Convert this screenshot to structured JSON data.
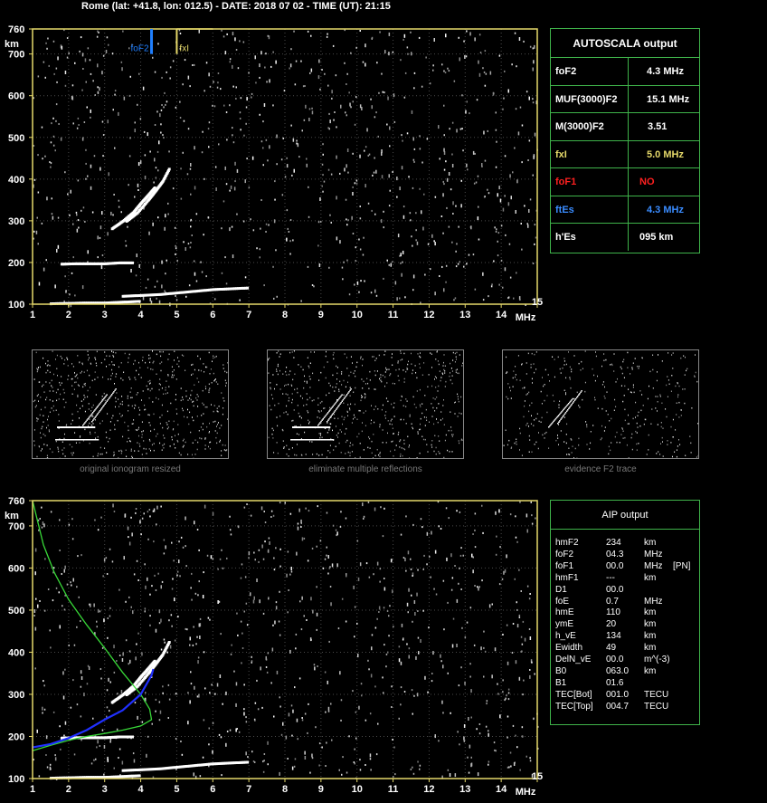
{
  "header": {
    "title": "Rome (lat: +41.8, lon: 012.5) - DATE: 2018 07 02 - TIME (UT): 21:15"
  },
  "colors": {
    "frame": "#e6d96a",
    "grid": "#4a4a4a",
    "panel_border": "#3fb34a",
    "foF2_marker": "#1f7fff",
    "fxI_marker": "#e6d96a",
    "value_white": "#ffffff",
    "value_yellow": "#e6d96a",
    "value_red": "#ff2020",
    "value_blue": "#3a8cff",
    "profile_green": "#38d838",
    "profile_blue": "#2030ff"
  },
  "chart_data": [
    {
      "type": "scatter",
      "id": "ionogram-top",
      "xlabel": "MHz",
      "ylabel": "km",
      "xlim": [
        1,
        15
      ],
      "ylim": [
        100,
        760
      ],
      "xticks": [
        1,
        2,
        3,
        4,
        5,
        6,
        7,
        8,
        9,
        10,
        11,
        12,
        13,
        14,
        15
      ],
      "yticks": [
        100,
        200,
        300,
        400,
        500,
        600,
        700,
        760
      ],
      "grid": true,
      "markers": [
        {
          "label": "foF2",
          "x": 4.3
        },
        {
          "label": "fxI",
          "x": 5.0
        }
      ],
      "traces": [
        {
          "name": "",
          "points": [
            [
              1.5,
              102
            ],
            [
              2.0,
              103
            ],
            [
              2.5,
              104
            ],
            [
              3.0,
              104
            ],
            [
              3.5,
              106
            ],
            [
              4.0,
              108
            ]
          ]
        },
        {
          "name": "",
          "points": [
            [
              1.8,
              197
            ],
            [
              2.2,
              198
            ],
            [
              2.6,
              198
            ],
            [
              3.0,
              198
            ],
            [
              3.4,
              200
            ],
            [
              3.8,
              200
            ]
          ]
        },
        {
          "name": "",
          "points": [
            [
              3.2,
              282
            ],
            [
              3.5,
              300
            ],
            [
              3.8,
              322
            ],
            [
              4.0,
              343
            ],
            [
              4.2,
              362
            ],
            [
              4.4,
              382
            ]
          ]
        },
        {
          "name": "",
          "points": [
            [
              3.6,
              300
            ],
            [
              3.9,
              320
            ],
            [
              4.2,
              350
            ],
            [
              4.4,
              372
            ],
            [
              4.6,
              395
            ],
            [
              4.8,
              428
            ]
          ]
        },
        {
          "name": "",
          "points": [
            [
              3.5,
              120
            ],
            [
              4.0,
              122
            ],
            [
              4.5,
              124
            ],
            [
              5.0,
              128
            ],
            [
              5.5,
              132
            ],
            [
              6.0,
              136
            ],
            [
              6.5,
              138
            ],
            [
              7.0,
              140
            ]
          ]
        }
      ]
    },
    {
      "type": "scatter",
      "id": "ionogram-bottom",
      "xlabel": "MHz",
      "ylabel": "km",
      "xlim": [
        1,
        15
      ],
      "ylim": [
        100,
        760
      ],
      "xticks": [
        1,
        2,
        3,
        4,
        5,
        6,
        7,
        8,
        9,
        10,
        11,
        12,
        13,
        14,
        15
      ],
      "yticks": [
        100,
        200,
        300,
        400,
        500,
        600,
        700,
        760
      ],
      "grid": true,
      "traces": [
        {
          "name": "",
          "points": [
            [
              1.5,
              102
            ],
            [
              2.0,
              103
            ],
            [
              2.5,
              104
            ],
            [
              3.0,
              104
            ],
            [
              3.5,
              106
            ],
            [
              4.0,
              108
            ]
          ]
        },
        {
          "name": "",
          "points": [
            [
              1.8,
              197
            ],
            [
              2.2,
              198
            ],
            [
              2.6,
              198
            ],
            [
              3.0,
              198
            ],
            [
              3.4,
              200
            ],
            [
              3.8,
              200
            ]
          ]
        },
        {
          "name": "",
          "points": [
            [
              3.2,
              282
            ],
            [
              3.5,
              300
            ],
            [
              3.8,
              322
            ],
            [
              4.0,
              343
            ],
            [
              4.2,
              362
            ],
            [
              4.4,
              382
            ]
          ]
        },
        {
          "name": "",
          "points": [
            [
              3.6,
              300
            ],
            [
              3.9,
              320
            ],
            [
              4.2,
              350
            ],
            [
              4.4,
              372
            ],
            [
              4.6,
              395
            ],
            [
              4.8,
              428
            ]
          ]
        },
        {
          "name": "",
          "points": [
            [
              3.5,
              120
            ],
            [
              4.0,
              122
            ],
            [
              4.5,
              124
            ],
            [
              5.0,
              128
            ],
            [
              5.5,
              132
            ],
            [
              6.0,
              136
            ],
            [
              6.5,
              138
            ],
            [
              7.0,
              140
            ]
          ]
        }
      ],
      "profiles": [
        {
          "name": "",
          "color": "profile_green",
          "points": [
            [
              1.0,
              760
            ],
            [
              1.3,
              655
            ],
            [
              1.6,
              590
            ],
            [
              2.0,
              525
            ],
            [
              2.5,
              465
            ],
            [
              3.0,
              410
            ],
            [
              3.5,
              352
            ],
            [
              4.0,
              300
            ],
            [
              4.25,
              265
            ],
            [
              4.3,
              240
            ],
            [
              4.0,
              225
            ],
            [
              3.5,
              215
            ],
            [
              3.0,
              207
            ],
            [
              2.5,
              200
            ],
            [
              2.0,
              191
            ],
            [
              1.5,
              179
            ],
            [
              1.0,
              166
            ]
          ]
        },
        {
          "name": "",
          "color": "profile_blue",
          "points": [
            [
              1.0,
              174
            ],
            [
              1.5,
              182
            ],
            [
              2.0,
              196
            ],
            [
              2.5,
              215
            ],
            [
              3.0,
              240
            ],
            [
              3.5,
              262
            ],
            [
              4.0,
              300
            ],
            [
              4.3,
              345
            ],
            [
              4.35,
              360
            ]
          ]
        }
      ]
    }
  ],
  "autoscala": {
    "title": "AUTOSCALA output",
    "rows": [
      {
        "label": "foF2",
        "value": "4.3 MHz",
        "label_color": "value_white",
        "value_color": "value_white"
      },
      {
        "label": "MUF(3000)F2",
        "value": "15.1 MHz",
        "label_color": "value_white",
        "value_color": "value_white"
      },
      {
        "label": "M(3000)F2",
        "value": "3.51",
        "label_color": "value_white",
        "value_color": "value_white"
      },
      {
        "label": "fxI",
        "value": "5.0 MHz",
        "label_color": "value_yellow",
        "value_color": "value_yellow"
      },
      {
        "label": "foF1",
        "value": "NO",
        "label_color": "value_red",
        "value_color": "value_red"
      },
      {
        "label": "ftEs",
        "value": "4.3 MHz",
        "label_color": "value_blue",
        "value_color": "value_blue"
      },
      {
        "label": "h'Es",
        "value": "095     km",
        "label_color": "value_white",
        "value_color": "value_white"
      }
    ]
  },
  "thumbnails": [
    {
      "caption": "original ionogram resized"
    },
    {
      "caption": "eliminate multiple reflections"
    },
    {
      "caption": "evidence F2 trace"
    }
  ],
  "aip": {
    "title": "AIP output",
    "rows": [
      {
        "param": "hmF2",
        "value": "234",
        "unit": "km",
        "extra": ""
      },
      {
        "param": "foF2",
        "value": "04.3",
        "unit": "MHz",
        "extra": ""
      },
      {
        "param": "foF1",
        "value": "00.0",
        "unit": "MHz",
        "extra": "[PN]"
      },
      {
        "param": "hmF1",
        "value": "---",
        "unit": "km",
        "extra": ""
      },
      {
        "param": "D1",
        "value": "00.0",
        "unit": "",
        "extra": ""
      },
      {
        "param": "foE",
        "value": "0.7",
        "unit": "MHz",
        "extra": ""
      },
      {
        "param": "hmE",
        "value": "110",
        "unit": "km",
        "extra": ""
      },
      {
        "param": "ymE",
        "value": "20",
        "unit": "km",
        "extra": ""
      },
      {
        "param": "h_vE",
        "value": "134",
        "unit": "km",
        "extra": ""
      },
      {
        "param": "Ewidth",
        "value": "49",
        "unit": "km",
        "extra": ""
      },
      {
        "param": "DelN_vE",
        "value": "00.0",
        "unit": "m^(-3)",
        "extra": ""
      },
      {
        "param": "B0",
        "value": "063.0",
        "unit": "km",
        "extra": ""
      },
      {
        "param": "B1",
        "value": "01.6",
        "unit": "",
        "extra": ""
      },
      {
        "param": "TEC[Bot]",
        "value": "001.0",
        "unit": "TECU",
        "extra": ""
      },
      {
        "param": "TEC[Top]",
        "value": "004.7",
        "unit": "TECU",
        "extra": ""
      }
    ]
  }
}
